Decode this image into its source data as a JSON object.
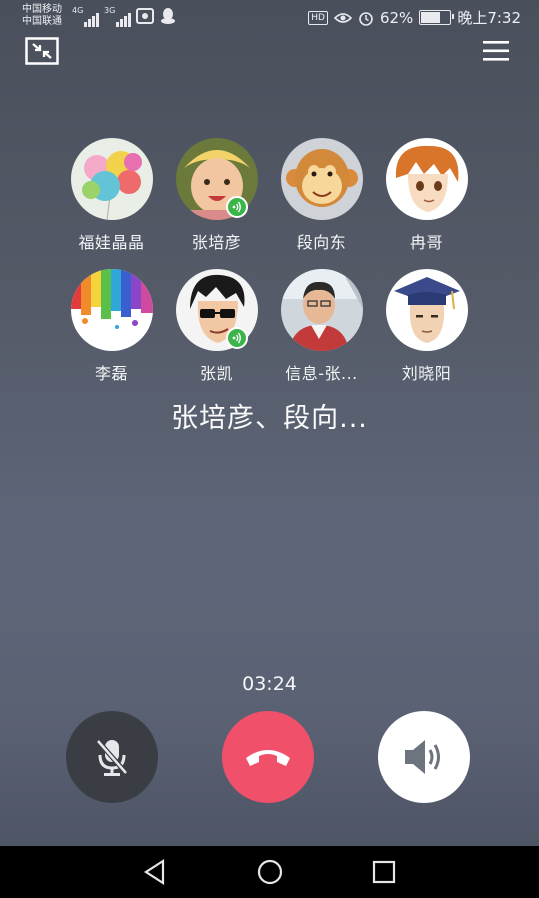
{
  "status_bar": {
    "carrier_1": "中国移动",
    "carrier_2": "中国联通",
    "net_1": "4G",
    "net_2": "3G",
    "hd": "HD",
    "battery": "62%",
    "time": "晚上7:32"
  },
  "participants": [
    {
      "name": "福娃晶晶",
      "avatar": "balloons",
      "speaking": false
    },
    {
      "name": "张培彦",
      "avatar": "baby",
      "speaking": true
    },
    {
      "name": "段向东",
      "avatar": "monkey",
      "speaking": false
    },
    {
      "name": "冉哥",
      "avatar": "anime-boy",
      "speaking": false
    },
    {
      "name": "李磊",
      "avatar": "paint-splash",
      "speaking": false
    },
    {
      "name": "张凯",
      "avatar": "sunglasses-cartoon",
      "speaking": true
    },
    {
      "name": "信息-张...",
      "avatar": "photo-man",
      "speaking": false
    },
    {
      "name": "刘晓阳",
      "avatar": "graduate-cartoon",
      "speaking": false
    }
  ],
  "call": {
    "title": "张培彦、段向...",
    "timer": "03:24"
  },
  "controls": {
    "mute_icon": "mic-off-icon",
    "hangup_icon": "phone-hangup-icon",
    "speaker_icon": "speaker-icon",
    "hangup_color": "#f0506a",
    "speaking_color": "#3bb54a"
  },
  "nav": {
    "back_icon": "back-triangle-icon",
    "home_icon": "home-circle-icon",
    "recents_icon": "recents-square-icon"
  }
}
